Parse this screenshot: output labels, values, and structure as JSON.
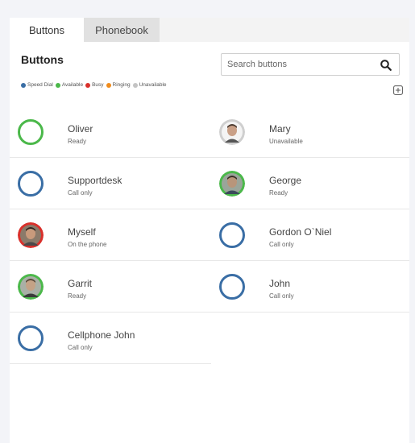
{
  "tabs": [
    {
      "label": "Buttons",
      "active": true
    },
    {
      "label": "Phonebook",
      "active": false
    }
  ],
  "title": "Buttons",
  "legend": [
    {
      "label": "Speed Dial",
      "color": "#3a6ea5"
    },
    {
      "label": "Available",
      "color": "#4bb84a"
    },
    {
      "label": "Busy",
      "color": "#d9302b"
    },
    {
      "label": "Ringing",
      "color": "#f08c1c"
    },
    {
      "label": "Unavailable",
      "color": "#c4c4c4"
    }
  ],
  "search": {
    "placeholder": "Search buttons",
    "icon": "search-icon"
  },
  "add_icon": "plus-square-icon",
  "buttons": [
    {
      "name": "Oliver",
      "status": "Ready",
      "type": "ring-green"
    },
    {
      "name": "Mary",
      "status": "Unavailable",
      "type": "avatar-grey"
    },
    {
      "name": "Supportdesk",
      "status": "Call only",
      "type": "ring"
    },
    {
      "name": "George",
      "status": "Ready",
      "type": "avatar-green"
    },
    {
      "name": "Myself",
      "status": "On the phone",
      "type": "avatar-red"
    },
    {
      "name": "Gordon O`Niel",
      "status": "Call only",
      "type": "ring"
    },
    {
      "name": "Garrit",
      "status": "Ready",
      "type": "avatar-green"
    },
    {
      "name": "John",
      "status": "Call only",
      "type": "ring"
    },
    {
      "name": "Cellphone John",
      "status": "Call only",
      "type": "ring"
    }
  ],
  "colors": {
    "speed_dial": "#3a6ea5",
    "available": "#4bb84a",
    "busy": "#d9302b",
    "ringing": "#f08c1c",
    "unavailable": "#c4c4c4"
  }
}
